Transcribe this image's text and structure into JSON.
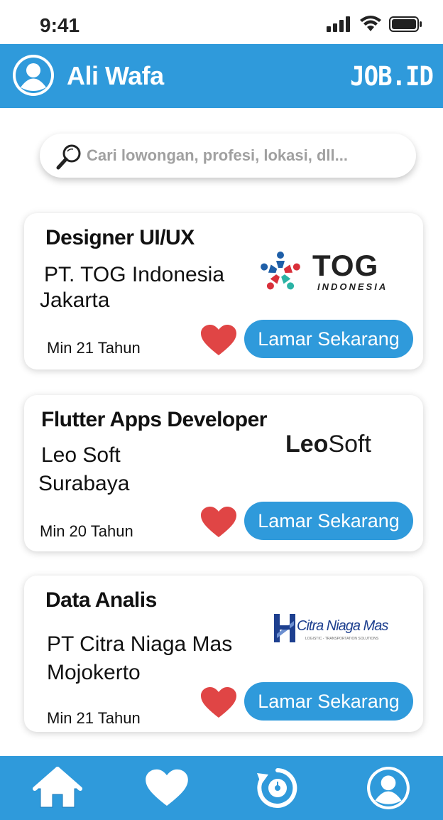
{
  "status_bar": {
    "time": "9:41"
  },
  "header": {
    "user_name": "Ali Wafa",
    "brand": "JOB.ID"
  },
  "search": {
    "placeholder": "Cari lowongan, profesi, lokasi, dll..."
  },
  "jobs": [
    {
      "title": "Designer UI/UX",
      "company": "PT. TOG Indonesia",
      "city": "Jakarta",
      "age_requirement": "Min 21 Tahun",
      "apply_label": "Lamar Sekarang",
      "logo": {
        "name": "TOG",
        "subtitle": "INDONESIA"
      }
    },
    {
      "title": "Flutter Apps Developer",
      "company": "Leo Soft",
      "city": "Surabaya",
      "age_requirement": "Min  20 Tahun",
      "apply_label": "Lamar Sekarang",
      "logo": {
        "name_bold": "Leo",
        "name_light": "Soft"
      }
    },
    {
      "title": "Data Analis",
      "company": "PT Citra Niaga Mas",
      "city": "Mojokerto",
      "age_requirement": "Min 21 Tahun",
      "apply_label": "Lamar Sekarang",
      "logo": {
        "name": "Citra Niaga Mas",
        "subtitle": "LOGISTIC - TRANSPORTATION SOLUTIONS"
      }
    }
  ],
  "nav": {
    "items": [
      {
        "icon": "home-icon"
      },
      {
        "icon": "heart-icon"
      },
      {
        "icon": "history-icon"
      },
      {
        "icon": "profile-icon"
      }
    ]
  },
  "colors": {
    "primary": "#2F9ADB",
    "heart": "#E04545",
    "background": "#FFFFFF"
  }
}
